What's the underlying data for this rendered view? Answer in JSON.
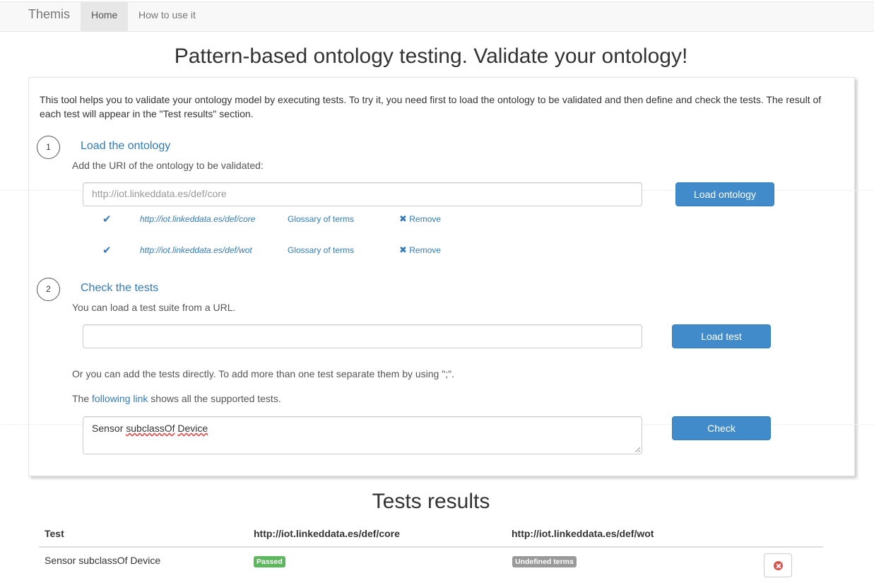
{
  "navbar": {
    "brand": "Themis",
    "items": [
      {
        "label": "Home",
        "active": true
      },
      {
        "label": "How to use it",
        "active": false
      }
    ]
  },
  "page_title": "Pattern-based ontology testing. Validate your ontology!",
  "intro_line1": "This tool helps you to validate your ontology model by executing tests. To try it, you need first to load the ontology to be validated and then define and check the tests. The result of",
  "intro_line2": "each test will appear in the \"Test results\" section.",
  "step1": {
    "number": "1",
    "title": "Load the ontology",
    "subtitle": "Add the URI of the ontology to be validated:",
    "input_placeholder": "http://iot.linkeddata.es/def/core",
    "button": "Load ontology",
    "ontologies": [
      {
        "uri": "http://iot.linkeddata.es/def/core",
        "glossary": "Glossary of terms",
        "remove": "Remove"
      },
      {
        "uri": "http://iot.linkeddata.es/def/wot",
        "glossary": "Glossary of terms",
        "remove": "Remove"
      }
    ]
  },
  "step2": {
    "number": "2",
    "title": "Check the tests",
    "subtitle": "You can load a test suite from a URL.",
    "url_input_value": "",
    "load_button": "Load test",
    "direct_text": "Or you can add the tests directly. To add more than one test separate them by using \";\".",
    "link_prefix": "The ",
    "link_text": "following link",
    "link_suffix": " shows all the supported tests.",
    "tests_text": {
      "word1": "Sensor",
      "word2": "subclassOf",
      "word3": "Device"
    },
    "check_button": "Check"
  },
  "results": {
    "title": "Tests results",
    "columns": [
      "Test",
      "http://iot.linkeddata.es/def/core",
      "http://iot.linkeddata.es/def/wot"
    ],
    "rows": [
      {
        "test": "Sensor subclassOf Device",
        "core": "Passed",
        "wot": "Undefined terms"
      }
    ]
  },
  "colors": {
    "primary": "#428bca",
    "link": "#337ab7",
    "success": "#5cb85c",
    "default_label": "#999999",
    "danger": "#d9534f"
  }
}
